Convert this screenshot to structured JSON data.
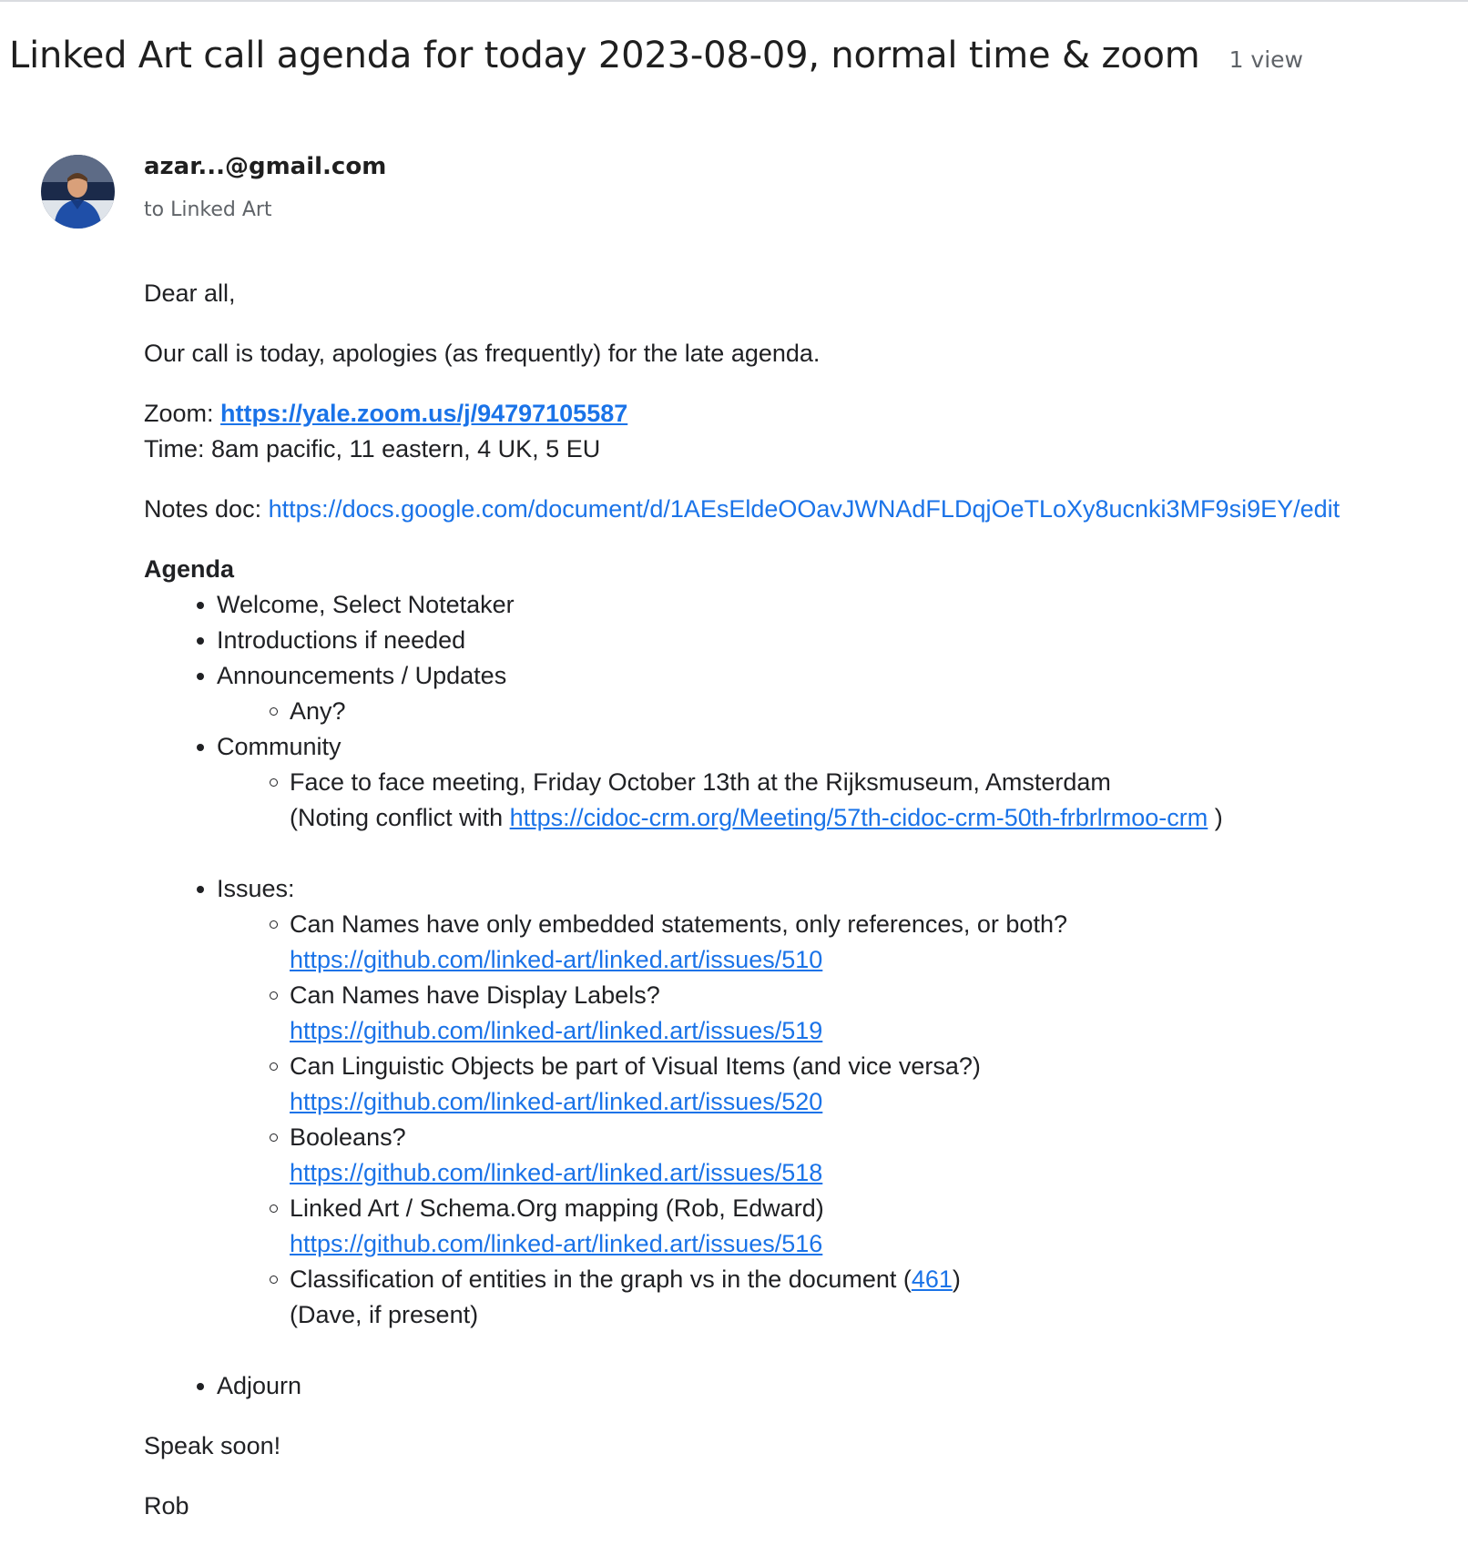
{
  "header": {
    "subject": "Linked Art call agenda for today 2023-08-09, normal time & zoom",
    "views": "1 view"
  },
  "message": {
    "sender": "azar...@gmail.com",
    "recipient": "to Linked Art",
    "greeting": "Dear all,",
    "intro": "Our call is today, apologies (as frequently) for the late agenda.",
    "zoom_label": "Zoom: ",
    "zoom_link": "https://yale.zoom.us/j/94797105587",
    "time_line": "Time: 8am pacific, 11 eastern, 4 UK, 5 EU",
    "notes_label": "Notes doc: ",
    "notes_link": "https://docs.google.com/document/d/1AEsEldeOOavJWNAdFLDqjOeTLoXy8ucnki3MF9si9EY/edit",
    "agenda_heading": "Agenda",
    "agenda": {
      "welcome": "Welcome, Select Notetaker",
      "introductions": "Introductions if needed",
      "announcements": "Announcements / Updates",
      "announcements_any": "Any?",
      "community": "Community",
      "community_meeting": "Face to face meeting, Friday October 13th at the Rijksmuseum, Amsterdam",
      "community_conflict_prefix": "(Noting conflict with ",
      "community_conflict_link": "https://cidoc-crm.org/Meeting/57th-cidoc-crm-50th-frbrlrmoo-crm",
      "community_conflict_suffix": " )",
      "issues": "Issues:",
      "issue_items": [
        {
          "title": "Can Names have only embedded statements,  only references, or both?",
          "link": "https://github.com/linked-art/linked.art/issues/510"
        },
        {
          "title": "Can Names have Display Labels?",
          "link": "https://github.com/linked-art/linked.art/issues/519"
        },
        {
          "title": "Can Linguistic Objects be part of Visual Items (and vice versa?)",
          "link": "https://github.com/linked-art/linked.art/issues/520"
        },
        {
          "title": "Booleans?",
          "link": "https://github.com/linked-art/linked.art/issues/518"
        },
        {
          "title": "Linked Art / Schema.Org mapping (Rob, Edward)",
          "link": "https://github.com/linked-art/linked.art/issues/516"
        }
      ],
      "classification_prefix": "Classification of entities in the graph vs in the document (",
      "classification_link": "461",
      "classification_suffix": ")",
      "classification_note": "(Dave, if present)",
      "adjourn": "Adjourn"
    },
    "closing": "Speak soon!",
    "signature": "Rob"
  },
  "colors": {
    "link": "#1a73e8",
    "text": "#202124",
    "secondary": "#5f6368"
  }
}
